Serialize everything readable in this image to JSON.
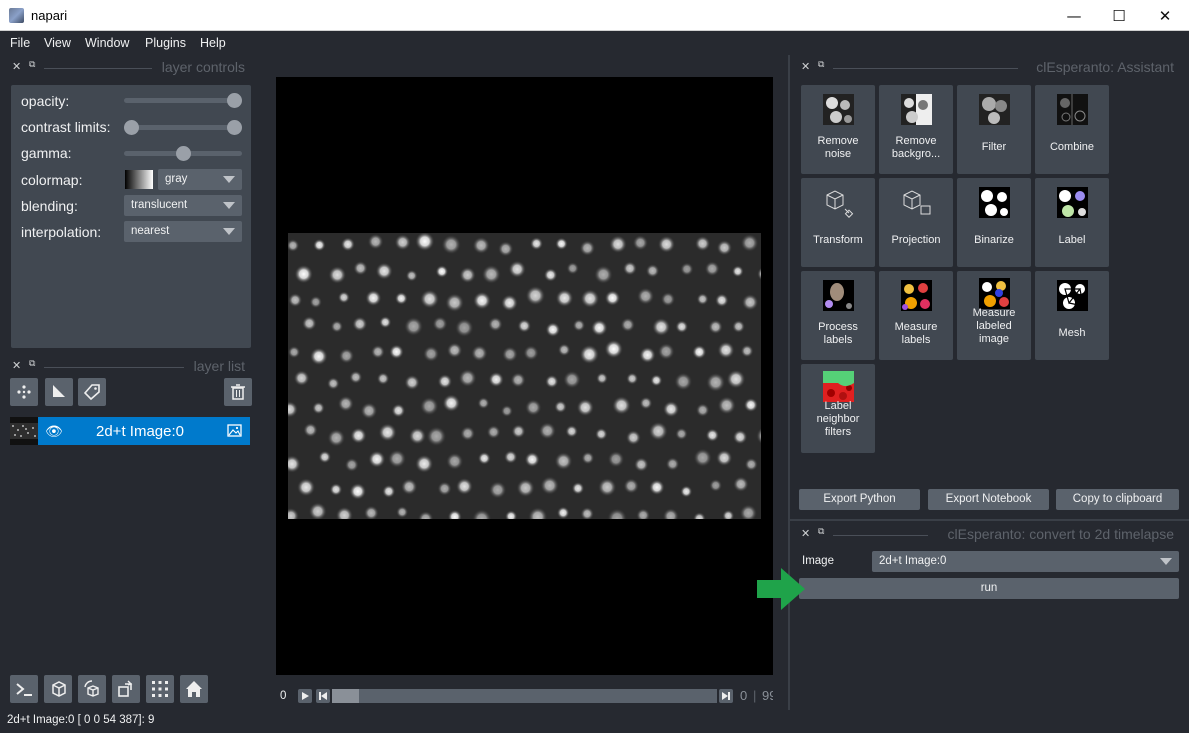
{
  "window": {
    "title": "napari",
    "minimize": "—",
    "maximize": "☐",
    "close": "✕"
  },
  "menu": [
    "File",
    "View",
    "Window",
    "Plugins",
    "Help"
  ],
  "layer_controls": {
    "title": "layer controls",
    "labels": {
      "opacity": "opacity:",
      "contrast": "contrast limits:",
      "gamma": "gamma:",
      "colormap": "colormap:",
      "blending": "blending:",
      "interpolation": "interpolation:"
    },
    "opacity_value": 1.0,
    "contrast_values": [
      0.0,
      1.0
    ],
    "gamma_value": 0.5,
    "colormap": "gray",
    "blending": "translucent",
    "interpolation": "nearest"
  },
  "layer_list": {
    "title": "layer list",
    "layers": [
      {
        "name": "2d+t Image:0",
        "visible": true,
        "selected": true
      }
    ]
  },
  "dims": {
    "current": "0",
    "frame": "0",
    "max": "99",
    "position": 0.0
  },
  "status": "2d+t Image:0 [  0    0  54 387]: 9",
  "assistant": {
    "title": "clEsperanto: Assistant",
    "tiles": [
      {
        "label": "Remove\nnoise",
        "icon": "blobs-icon"
      },
      {
        "label": "Remove\nbackgro...",
        "icon": "half-blobs-icon"
      },
      {
        "label": "Filter",
        "icon": "filter-blobs-icon"
      },
      {
        "label": "Combine",
        "icon": "combine-icon"
      },
      {
        "label": "Transform",
        "icon": "transform-cube-icon"
      },
      {
        "label": "Projection",
        "icon": "projection-cube-icon"
      },
      {
        "label": "Binarize",
        "icon": "binary-blobs-icon"
      },
      {
        "label": "Label",
        "icon": "colored-labels-icon"
      },
      {
        "label": "Process\nlabels",
        "icon": "process-labels-icon"
      },
      {
        "label": "Measure\nlabels",
        "icon": "measure-labels-icon"
      },
      {
        "label": "Measure\nlabeled\nimage",
        "icon": "measure-image-icon"
      },
      {
        "label": "Mesh",
        "icon": "mesh-icon"
      },
      {
        "label": "Label\nneighbor\nfilters",
        "icon": "neighbor-filter-icon"
      }
    ],
    "buttons": {
      "export_python": "Export Python",
      "export_notebook": "Export Notebook",
      "copy": "Copy to clipboard"
    }
  },
  "timelapse": {
    "title": "clEsperanto: convert to 2d timelapse",
    "image_label": "Image",
    "image_value": "2d+t Image:0",
    "run_label": "run"
  },
  "colors": {
    "background": "#262930",
    "panel": "#414851",
    "control": "#5a626c",
    "selection": "#007acc",
    "arrow": "#1fa34a"
  }
}
